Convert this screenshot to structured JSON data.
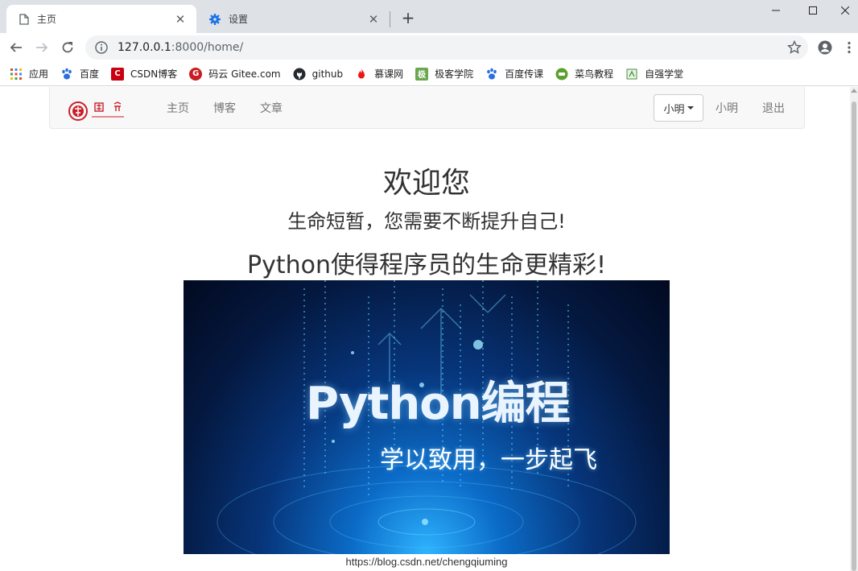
{
  "browser": {
    "tabs": [
      {
        "title": "主页",
        "icon": "page-icon",
        "active": true
      },
      {
        "title": "设置",
        "icon": "settings-gear-icon",
        "active": false
      }
    ],
    "address": {
      "host": "127.0.0.1",
      "rest": ":8000/home/"
    },
    "bookmarks": [
      {
        "label": "应用",
        "icon": "apps-grid-icon",
        "color": "#4285f4"
      },
      {
        "label": "百度",
        "icon": "baidu-paw-icon",
        "color": "#2a6ee0"
      },
      {
        "label": "CSDN博客",
        "icon": "csdn-icon",
        "color": "#c9000f"
      },
      {
        "label": "码云 Gitee.com",
        "icon": "gitee-icon",
        "color": "#c71d23"
      },
      {
        "label": "github",
        "icon": "github-icon",
        "color": "#24292e"
      },
      {
        "label": "慕课网",
        "icon": "imooc-flame-icon",
        "color": "#f01414"
      },
      {
        "label": "极客学院",
        "icon": "jikexueyuan-icon",
        "color": "#6aa84f"
      },
      {
        "label": "百度传课",
        "icon": "baidu-paw-icon",
        "color": "#2a6ee0"
      },
      {
        "label": "菜鸟教程",
        "icon": "runoob-icon",
        "color": "#5aa02c"
      },
      {
        "label": "自强学堂",
        "icon": "ziqiang-icon",
        "color": "#4a8f3c"
      }
    ]
  },
  "site": {
    "nav": {
      "links": [
        "主页",
        "博客",
        "文章"
      ],
      "user_dropdown": "小明",
      "user_link": "小明",
      "logout": "退出"
    },
    "welcome": {
      "title": "欢迎您",
      "line1": "生命短暂，您需要不断提升自己!",
      "line2": "Python使得程序员的生命更精彩!"
    },
    "banner": {
      "title": "Python编程",
      "subtitle": "学以致用，一步起飞"
    },
    "caption": "https://blog.csdn.net/chengqiuming"
  }
}
